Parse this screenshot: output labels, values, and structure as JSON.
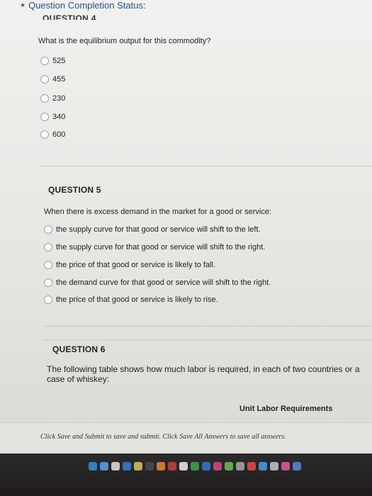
{
  "status": {
    "label": "Question Completion Status:"
  },
  "q4": {
    "title": "QUESTION 4",
    "text": "What is the equilibrium output for this commodity?",
    "options": [
      "525",
      "455",
      "230",
      "340",
      "600"
    ]
  },
  "q5": {
    "title": "QUESTION 5",
    "text": "When there is excess demand in the market for a good or service:",
    "options": [
      "the supply curve for that good or service will shift to the left.",
      "the supply curve for that good or service will shift to the right.",
      "the price of that good or service is likely to fall.",
      "the demand curve for that good or service will shift to the right.",
      "the price of that good or service is likely to rise."
    ]
  },
  "q6": {
    "title": "QUESTION 6",
    "text": "The following table shows how much labor is required, in each of two countries or a case of whiskey:",
    "table_heading": "Unit Labor Requirements"
  },
  "footer": {
    "text": "Click Save and Submit to save and submit. Click Save All Answers to save all answers."
  },
  "colors": {
    "link_blue": "#2b4f86",
    "dock": "#221f20"
  }
}
